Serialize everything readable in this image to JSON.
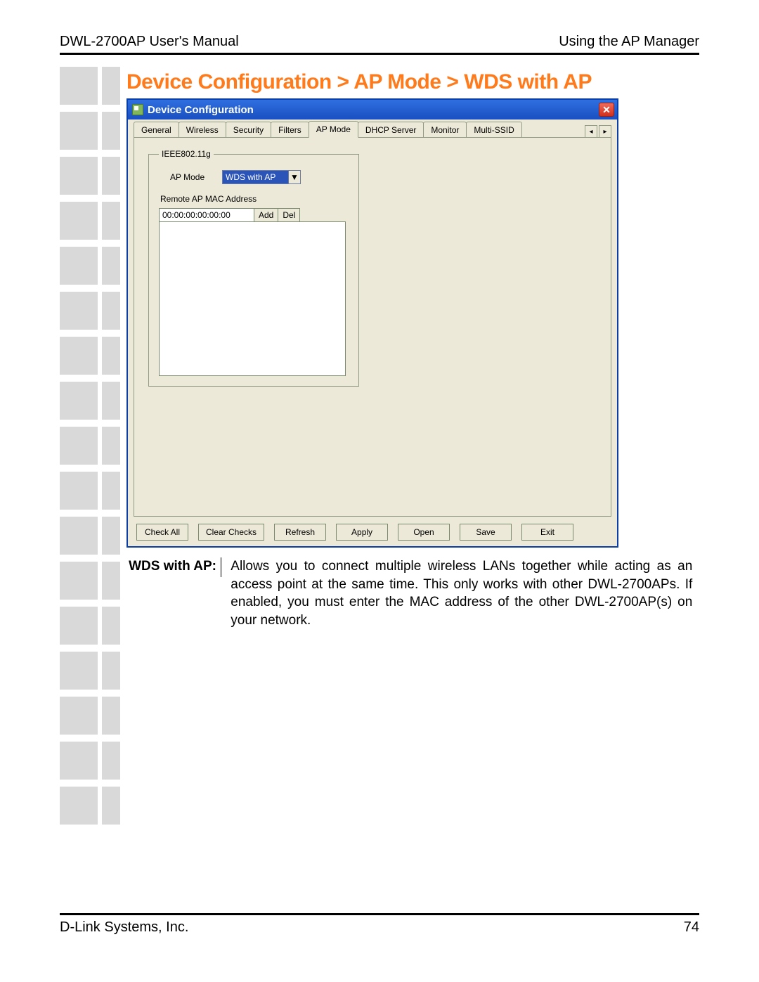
{
  "header": {
    "left": "DWL-2700AP User's Manual",
    "right": "Using the AP Manager"
  },
  "footer": {
    "left": "D-Link Systems, Inc.",
    "right": "74"
  },
  "breadcrumb": "Device Configuration > AP Mode > WDS with AP",
  "window": {
    "title": "Device Configuration",
    "tabs": [
      "General",
      "Wireless",
      "Security",
      "Filters",
      "AP Mode",
      "DHCP Server",
      "Monitor",
      "Multi-SSID"
    ],
    "active_tab_index": 4,
    "groupbox": {
      "legend": "IEEE802.11g",
      "ap_mode_label": "AP Mode",
      "ap_mode_value": "WDS with AP",
      "remote_label": "Remote AP MAC Address",
      "mac_value": "00:00:00:00:00:00",
      "add_label": "Add",
      "del_label": "Del"
    },
    "buttons": {
      "check_all": "Check All",
      "clear_checks": "Clear Checks",
      "refresh": "Refresh",
      "apply": "Apply",
      "open": "Open",
      "save": "Save",
      "exit": "Exit"
    }
  },
  "description": {
    "label": "WDS with AP:",
    "text": "Allows you to connect multiple wireless LANs together while acting as an access point at the same time. This only works with other DWL-2700APs. If enabled, you must enter the MAC address of the other DWL-2700AP(s) on your network."
  }
}
